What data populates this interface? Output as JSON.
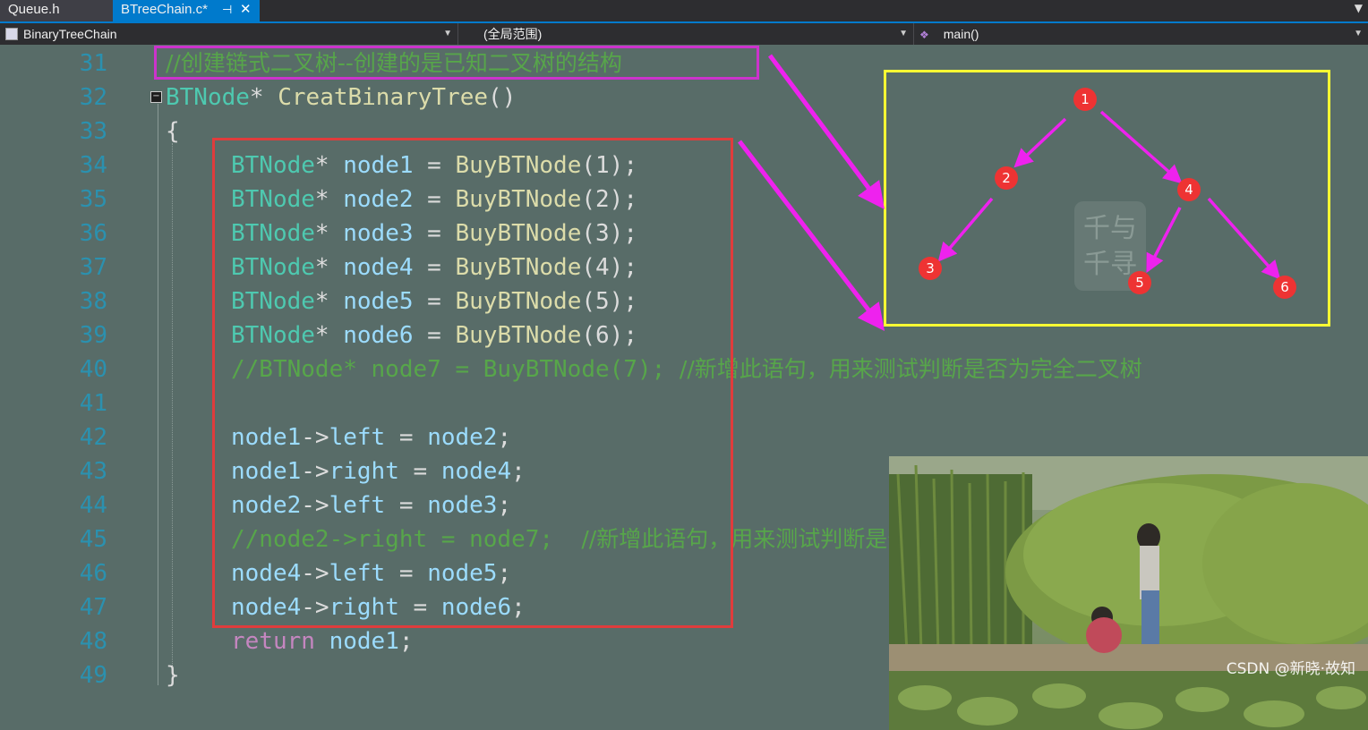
{
  "tabs": [
    {
      "label": "Queue.h",
      "active": false
    },
    {
      "label": "BTreeChain.c*",
      "active": true
    }
  ],
  "tab_pin_glyph": "⊣",
  "tab_close_glyph": "✕",
  "navbar": {
    "project": "BinaryTreeChain",
    "scope": "(全局范围)",
    "member": "main()"
  },
  "editor": {
    "lines": [
      {
        "no": "31",
        "tokens": [
          {
            "t": "cm-cn",
            "v": "//创建链式二叉树--创建的是已知二叉树的结构"
          }
        ],
        "indent": 1
      },
      {
        "no": "32",
        "tokens": [
          {
            "t": "t-type",
            "v": "BTNode"
          },
          {
            "t": "t-plain",
            "v": "* "
          },
          {
            "t": "t-fn",
            "v": "CreatBinaryTree"
          },
          {
            "t": "t-plain",
            "v": "()"
          }
        ],
        "indent": 0
      },
      {
        "no": "33",
        "tokens": [
          {
            "t": "t-plain",
            "v": "{"
          }
        ],
        "indent": 0
      },
      {
        "no": "34",
        "tokens": [
          {
            "t": "t-type",
            "v": "BTNode"
          },
          {
            "t": "t-plain",
            "v": "* "
          },
          {
            "t": "t-var",
            "v": "node1"
          },
          {
            "t": "t-plain",
            "v": " = "
          },
          {
            "t": "t-fn",
            "v": "BuyBTNode"
          },
          {
            "t": "t-plain",
            "v": "(1);"
          }
        ],
        "indent": 2
      },
      {
        "no": "35",
        "tokens": [
          {
            "t": "t-type",
            "v": "BTNode"
          },
          {
            "t": "t-plain",
            "v": "* "
          },
          {
            "t": "t-var",
            "v": "node2"
          },
          {
            "t": "t-plain",
            "v": " = "
          },
          {
            "t": "t-fn",
            "v": "BuyBTNode"
          },
          {
            "t": "t-plain",
            "v": "(2);"
          }
        ],
        "indent": 2
      },
      {
        "no": "36",
        "tokens": [
          {
            "t": "t-type",
            "v": "BTNode"
          },
          {
            "t": "t-plain",
            "v": "* "
          },
          {
            "t": "t-var",
            "v": "node3"
          },
          {
            "t": "t-plain",
            "v": " = "
          },
          {
            "t": "t-fn",
            "v": "BuyBTNode"
          },
          {
            "t": "t-plain",
            "v": "(3);"
          }
        ],
        "indent": 2
      },
      {
        "no": "37",
        "tokens": [
          {
            "t": "t-type",
            "v": "BTNode"
          },
          {
            "t": "t-plain",
            "v": "* "
          },
          {
            "t": "t-var",
            "v": "node4"
          },
          {
            "t": "t-plain",
            "v": " = "
          },
          {
            "t": "t-fn",
            "v": "BuyBTNode"
          },
          {
            "t": "t-plain",
            "v": "(4);"
          }
        ],
        "indent": 2
      },
      {
        "no": "38",
        "tokens": [
          {
            "t": "t-type",
            "v": "BTNode"
          },
          {
            "t": "t-plain",
            "v": "* "
          },
          {
            "t": "t-var",
            "v": "node5"
          },
          {
            "t": "t-plain",
            "v": " = "
          },
          {
            "t": "t-fn",
            "v": "BuyBTNode"
          },
          {
            "t": "t-plain",
            "v": "(5);"
          }
        ],
        "indent": 2
      },
      {
        "no": "39",
        "tokens": [
          {
            "t": "t-type",
            "v": "BTNode"
          },
          {
            "t": "t-plain",
            "v": "* "
          },
          {
            "t": "t-var",
            "v": "node6"
          },
          {
            "t": "t-plain",
            "v": " = "
          },
          {
            "t": "t-fn",
            "v": "BuyBTNode"
          },
          {
            "t": "t-plain",
            "v": "(6);"
          }
        ],
        "indent": 2
      },
      {
        "no": "40",
        "tokens": [
          {
            "t": "t-cm",
            "v": "//BTNode* node7 = BuyBTNode(7); "
          },
          {
            "t": "cm-cn",
            "v": "//新增此语句，用来测试判断是否为完全二叉树"
          }
        ],
        "indent": 2
      },
      {
        "no": "41",
        "tokens": [],
        "indent": 2
      },
      {
        "no": "42",
        "tokens": [
          {
            "t": "t-var",
            "v": "node1"
          },
          {
            "t": "t-plain",
            "v": "->"
          },
          {
            "t": "t-var",
            "v": "left"
          },
          {
            "t": "t-plain",
            "v": " = "
          },
          {
            "t": "t-var",
            "v": "node2"
          },
          {
            "t": "t-plain",
            "v": ";"
          }
        ],
        "indent": 2
      },
      {
        "no": "43",
        "tokens": [
          {
            "t": "t-var",
            "v": "node1"
          },
          {
            "t": "t-plain",
            "v": "->"
          },
          {
            "t": "t-var",
            "v": "right"
          },
          {
            "t": "t-plain",
            "v": " = "
          },
          {
            "t": "t-var",
            "v": "node4"
          },
          {
            "t": "t-plain",
            "v": ";"
          }
        ],
        "indent": 2
      },
      {
        "no": "44",
        "tokens": [
          {
            "t": "t-var",
            "v": "node2"
          },
          {
            "t": "t-plain",
            "v": "->"
          },
          {
            "t": "t-var",
            "v": "left"
          },
          {
            "t": "t-plain",
            "v": " = "
          },
          {
            "t": "t-var",
            "v": "node3"
          },
          {
            "t": "t-plain",
            "v": ";"
          }
        ],
        "indent": 2
      },
      {
        "no": "45",
        "tokens": [
          {
            "t": "t-cm",
            "v": "//node2->right = node7;  "
          },
          {
            "t": "cm-cn",
            "v": "//新增此语句，用来测试判断是否为完全二叉树"
          }
        ],
        "indent": 2
      },
      {
        "no": "46",
        "tokens": [
          {
            "t": "t-var",
            "v": "node4"
          },
          {
            "t": "t-plain",
            "v": "->"
          },
          {
            "t": "t-var",
            "v": "left"
          },
          {
            "t": "t-plain",
            "v": " = "
          },
          {
            "t": "t-var",
            "v": "node5"
          },
          {
            "t": "t-plain",
            "v": ";"
          }
        ],
        "indent": 2
      },
      {
        "no": "47",
        "tokens": [
          {
            "t": "t-var",
            "v": "node4"
          },
          {
            "t": "t-plain",
            "v": "->"
          },
          {
            "t": "t-var",
            "v": "right"
          },
          {
            "t": "t-plain",
            "v": " = "
          },
          {
            "t": "t-var",
            "v": "node6"
          },
          {
            "t": "t-plain",
            "v": ";"
          }
        ],
        "indent": 2
      },
      {
        "no": "48",
        "tokens": [
          {
            "t": "t-kw",
            "v": "return"
          },
          {
            "t": "t-plain",
            "v": " "
          },
          {
            "t": "t-var",
            "v": "node1"
          },
          {
            "t": "t-plain",
            "v": ";"
          }
        ],
        "indent": 2
      },
      {
        "no": "49",
        "tokens": [
          {
            "t": "t-plain",
            "v": "}"
          }
        ],
        "indent": 0
      }
    ]
  },
  "tree_diagram": {
    "nodes": [
      "1",
      "2",
      "4",
      "3",
      "5",
      "6"
    ],
    "node_color": "#ee3333",
    "arrow_color": "#ee22ee",
    "watermark_glyphs": "千与千寻"
  },
  "colors": {
    "annotation_magenta": "#cc33cc",
    "annotation_red": "#e03c3c",
    "annotation_yellow": "#ffff33",
    "arrow_magenta": "#ee22ee"
  },
  "watermark": "CSDN @新晓·故知"
}
